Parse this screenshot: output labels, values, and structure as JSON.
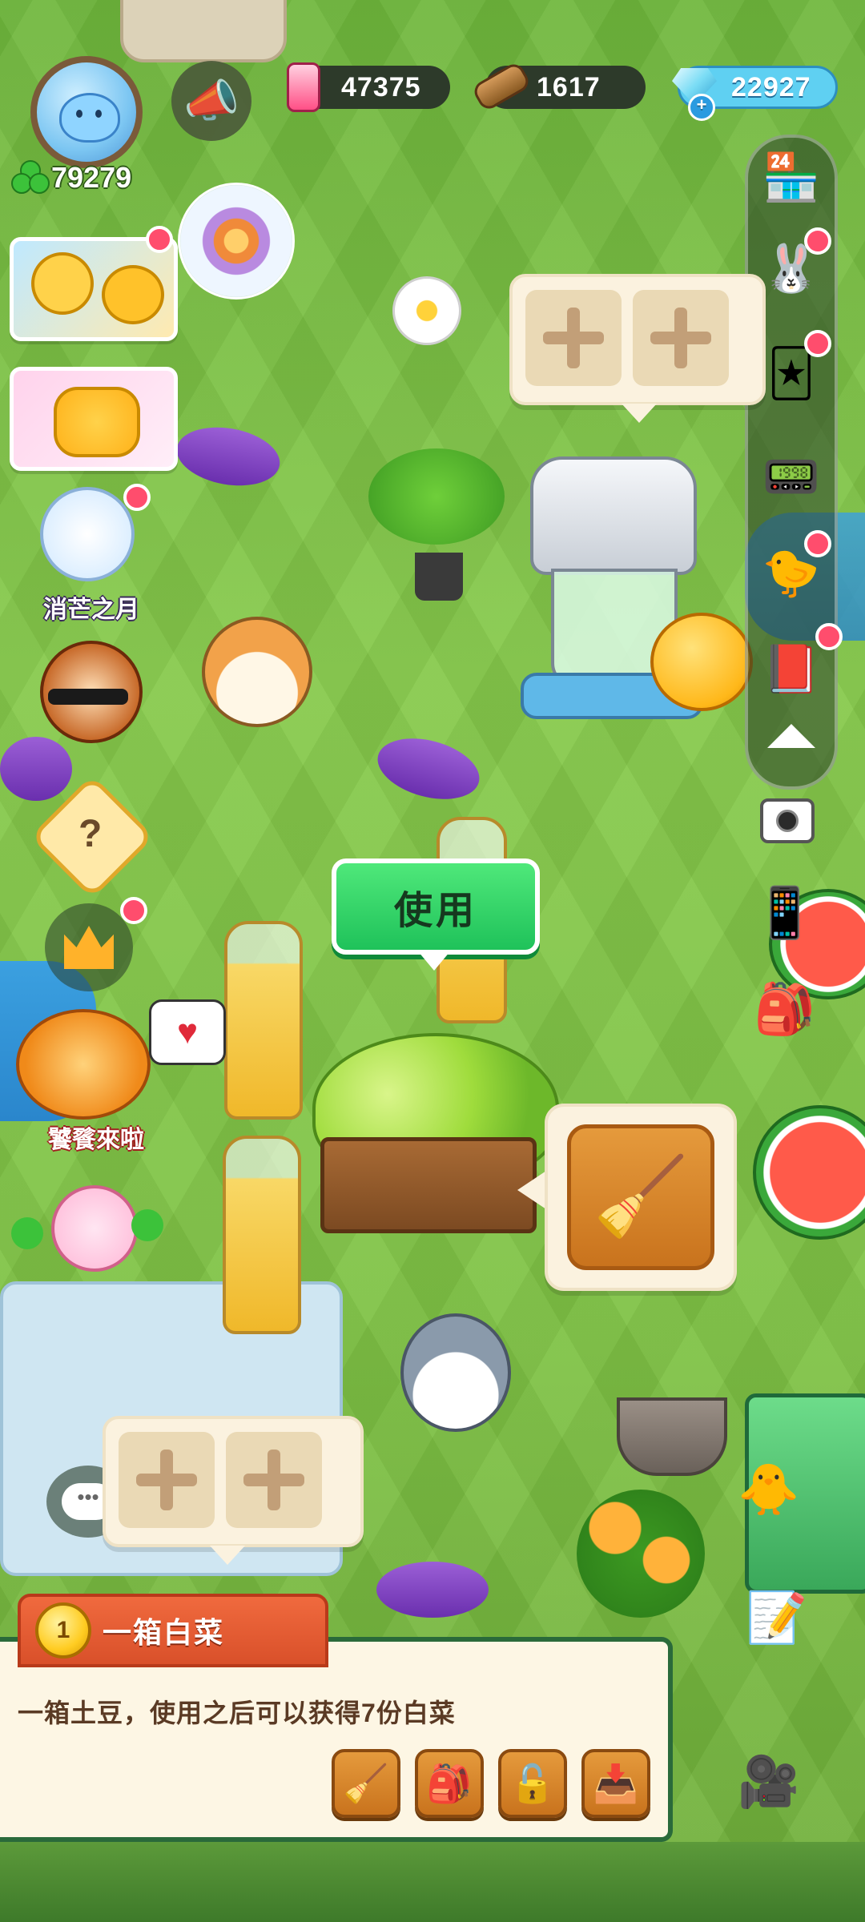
{
  "hud": {
    "player": {
      "clover_count": "79279"
    },
    "resources": [
      {
        "name": "potion",
        "value": "47375",
        "icon": "potion-icon",
        "color": "#ff4f86"
      },
      {
        "name": "wood",
        "value": "1617",
        "icon": "log-icon",
        "color": "#b07a44"
      },
      {
        "name": "gem",
        "value": "22927",
        "icon": "gem-icon",
        "color": "#5fd0f2"
      }
    ]
  },
  "left_menu": {
    "event_moon": {
      "label": "消芒之月"
    },
    "event_feast": {
      "label": "饕餮來啦"
    }
  },
  "world": {
    "use_button": {
      "label": "使用"
    }
  },
  "item_panel": {
    "rank": "1",
    "title": "一箱白菜",
    "description": "一箱土豆，使用之后可以获得7份白菜",
    "actions": [
      "sweep-icon",
      "backpack-icon",
      "unlock-icon",
      "collect-box-icon"
    ]
  },
  "colors": {
    "grass": "#7cc245",
    "use_green": "#1fc25a",
    "panel_border": "#2a6a3a",
    "tab_orange": "#d9502a",
    "action_orange": "#c9731d",
    "badge_red": "#ff4d6d"
  }
}
